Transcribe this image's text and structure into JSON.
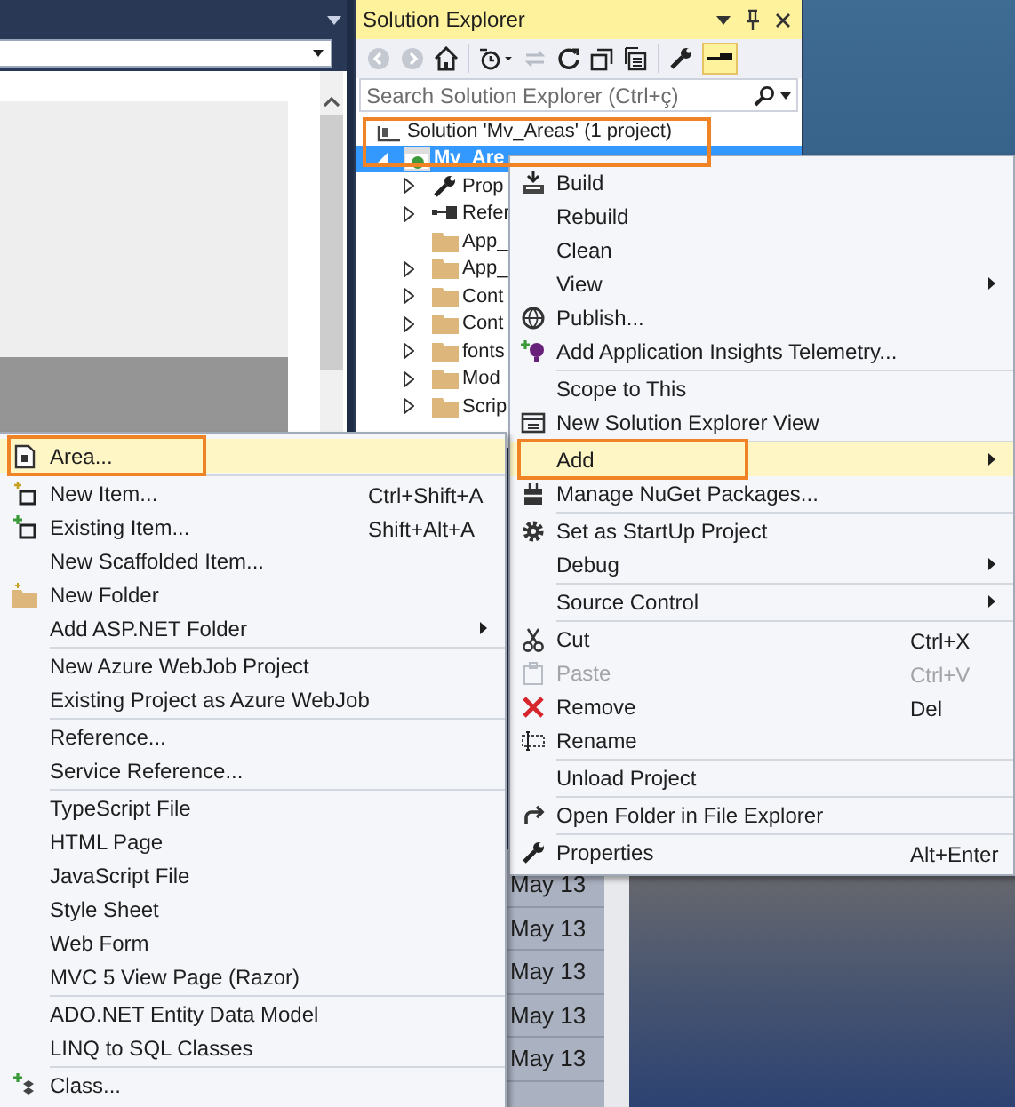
{
  "solution_explorer": {
    "title": "Solution Explorer",
    "search": {
      "placeholder": "Search Solution Explorer (Ctrl+ç)"
    },
    "tree": [
      {
        "label": "Solution 'Mv_Areas' (1 project)",
        "kind": "solution",
        "expandable": false,
        "selected": false,
        "children": [
          {
            "label": "Mv_Are",
            "kind": "project",
            "expandable": true,
            "selected": true,
            "children": [
              {
                "label": "Prop",
                "kind": "properties",
                "expandable": true,
                "selected": false
              },
              {
                "label": "Refer",
                "kind": "references",
                "expandable": true,
                "selected": false
              },
              {
                "label": "App_",
                "kind": "folder",
                "expandable": false,
                "selected": false
              },
              {
                "label": "App_",
                "kind": "folder",
                "expandable": true,
                "selected": false
              },
              {
                "label": "Cont",
                "kind": "folder",
                "expandable": true,
                "selected": false
              },
              {
                "label": "Cont",
                "kind": "folder",
                "expandable": true,
                "selected": false
              },
              {
                "label": "fonts",
                "kind": "folder",
                "expandable": true,
                "selected": false
              },
              {
                "label": "Mod",
                "kind": "folder",
                "expandable": true,
                "selected": false
              },
              {
                "label": "Scrip",
                "kind": "folder",
                "expandable": true,
                "selected": false
              }
            ]
          }
        ]
      }
    ]
  },
  "context_menu": {
    "groups": [
      [
        {
          "label": "Build",
          "submenu": false,
          "selected": false,
          "disabled": false
        },
        {
          "label": "Rebuild",
          "submenu": false,
          "selected": false,
          "disabled": false
        },
        {
          "label": "Clean",
          "submenu": false,
          "selected": false,
          "disabled": false
        },
        {
          "label": "View",
          "submenu": true,
          "selected": false,
          "disabled": false
        },
        {
          "label": "Publish...",
          "submenu": false,
          "selected": false,
          "disabled": false
        },
        {
          "label": "Add Application Insights Telemetry...",
          "submenu": false,
          "selected": false,
          "disabled": false
        }
      ],
      [
        {
          "label": "Scope to This",
          "submenu": false,
          "selected": false,
          "disabled": false
        },
        {
          "label": "New Solution Explorer View",
          "submenu": false,
          "selected": false,
          "disabled": false
        }
      ],
      [
        {
          "label": "Add",
          "submenu": true,
          "selected": true,
          "disabled": false
        },
        {
          "label": "Manage NuGet Packages...",
          "submenu": false,
          "selected": false,
          "disabled": false
        }
      ],
      [
        {
          "label": "Set as StartUp Project",
          "submenu": false,
          "selected": false,
          "disabled": false
        },
        {
          "label": "Debug",
          "submenu": true,
          "selected": false,
          "disabled": false
        }
      ],
      [
        {
          "label": "Source Control",
          "submenu": true,
          "selected": false,
          "disabled": false
        }
      ],
      [
        {
          "label": "Cut",
          "shortcut": "Ctrl+X",
          "submenu": false,
          "selected": false,
          "disabled": false
        },
        {
          "label": "Paste",
          "shortcut": "Ctrl+V",
          "submenu": false,
          "selected": false,
          "disabled": true
        },
        {
          "label": "Remove",
          "shortcut": "Del",
          "submenu": false,
          "selected": false,
          "disabled": false
        },
        {
          "label": "Rename",
          "submenu": false,
          "selected": false,
          "disabled": false
        }
      ],
      [
        {
          "label": "Unload Project",
          "submenu": false,
          "selected": false,
          "disabled": false
        }
      ],
      [
        {
          "label": "Open Folder in File Explorer",
          "submenu": false,
          "selected": false,
          "disabled": false
        }
      ],
      [
        {
          "label": "Properties",
          "shortcut": "Alt+Enter",
          "submenu": false,
          "selected": false,
          "disabled": false
        }
      ]
    ]
  },
  "add_submenu": {
    "groups": [
      [
        {
          "label": "Area...",
          "submenu": false,
          "selected": true,
          "disabled": false
        }
      ],
      [
        {
          "label": "New Item...",
          "shortcut": "Ctrl+Shift+A",
          "submenu": false,
          "selected": false,
          "disabled": false
        },
        {
          "label": "Existing Item...",
          "shortcut": "Shift+Alt+A",
          "submenu": false,
          "selected": false,
          "disabled": false
        },
        {
          "label": "New Scaffolded Item...",
          "submenu": false,
          "selected": false,
          "disabled": false
        },
        {
          "label": "New Folder",
          "submenu": false,
          "selected": false,
          "disabled": false
        },
        {
          "label": "Add ASP.NET Folder",
          "submenu": true,
          "selected": false,
          "disabled": false
        }
      ],
      [
        {
          "label": "New Azure WebJob Project",
          "submenu": false,
          "selected": false,
          "disabled": false
        },
        {
          "label": "Existing Project as Azure WebJob",
          "submenu": false,
          "selected": false,
          "disabled": false
        }
      ],
      [
        {
          "label": "Reference...",
          "submenu": false,
          "selected": false,
          "disabled": false
        },
        {
          "label": "Service Reference...",
          "submenu": false,
          "selected": false,
          "disabled": false
        }
      ],
      [
        {
          "label": "TypeScript File",
          "submenu": false,
          "selected": false,
          "disabled": false
        },
        {
          "label": "HTML Page",
          "submenu": false,
          "selected": false,
          "disabled": false
        },
        {
          "label": "JavaScript File",
          "submenu": false,
          "selected": false,
          "disabled": false
        },
        {
          "label": "Style Sheet",
          "submenu": false,
          "selected": false,
          "disabled": false
        },
        {
          "label": "Web Form",
          "submenu": false,
          "selected": false,
          "disabled": false
        },
        {
          "label": "MVC 5 View Page (Razor)",
          "submenu": false,
          "selected": false,
          "disabled": false
        }
      ],
      [
        {
          "label": "ADO.NET Entity Data Model",
          "submenu": false,
          "selected": false,
          "disabled": false
        },
        {
          "label": "LINQ to SQL Classes",
          "submenu": false,
          "selected": false,
          "disabled": false
        }
      ],
      [
        {
          "label": "Class...",
          "submenu": false,
          "selected": false,
          "disabled": false
        }
      ]
    ]
  },
  "file_list": {
    "dates": [
      "May 13",
      "May 13",
      "May 13",
      "May 13",
      "May 13"
    ]
  }
}
